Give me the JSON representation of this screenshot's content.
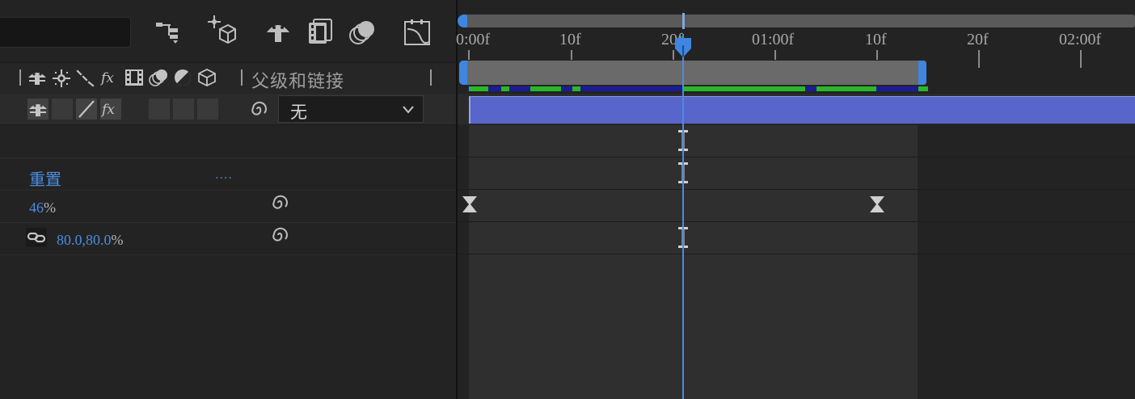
{
  "left_panel": {
    "header": {
      "parent_label": "父级和链接"
    },
    "layer": {
      "parent_value": "无"
    },
    "properties": [
      {
        "name": "重置",
        "dots": "...."
      },
      {
        "value": "46",
        "unit": "%"
      },
      {
        "value": "80.0,80.0",
        "unit": "%"
      }
    ]
  },
  "timeline": {
    "ticks": [
      {
        "label": "0:00f"
      },
      {
        "label": "10f"
      },
      {
        "label": "20f"
      },
      {
        "label": "01:00f"
      },
      {
        "label": "10f"
      },
      {
        "label": "20f"
      },
      {
        "label": "02:00f"
      }
    ]
  },
  "colors": {
    "accent_blue": "#4a8dde",
    "layer_bar": "#5866cc",
    "cache_green": "#28b828",
    "cache_blue": "#1b1b99"
  },
  "icons": {
    "toolbar": [
      "composition-flowchart-icon",
      "draft-3d-icon",
      "shy-layers-icon",
      "frame-blending-icon",
      "motion-blur-icon",
      "graph-editor-icon"
    ],
    "header_switches": [
      "shy-icon",
      "collapse-icon",
      "quality-icon",
      "effects-icon",
      "frame-blend-icon",
      "motion-blur-icon",
      "adjustment-layer-icon",
      "3d-layer-icon"
    ]
  }
}
